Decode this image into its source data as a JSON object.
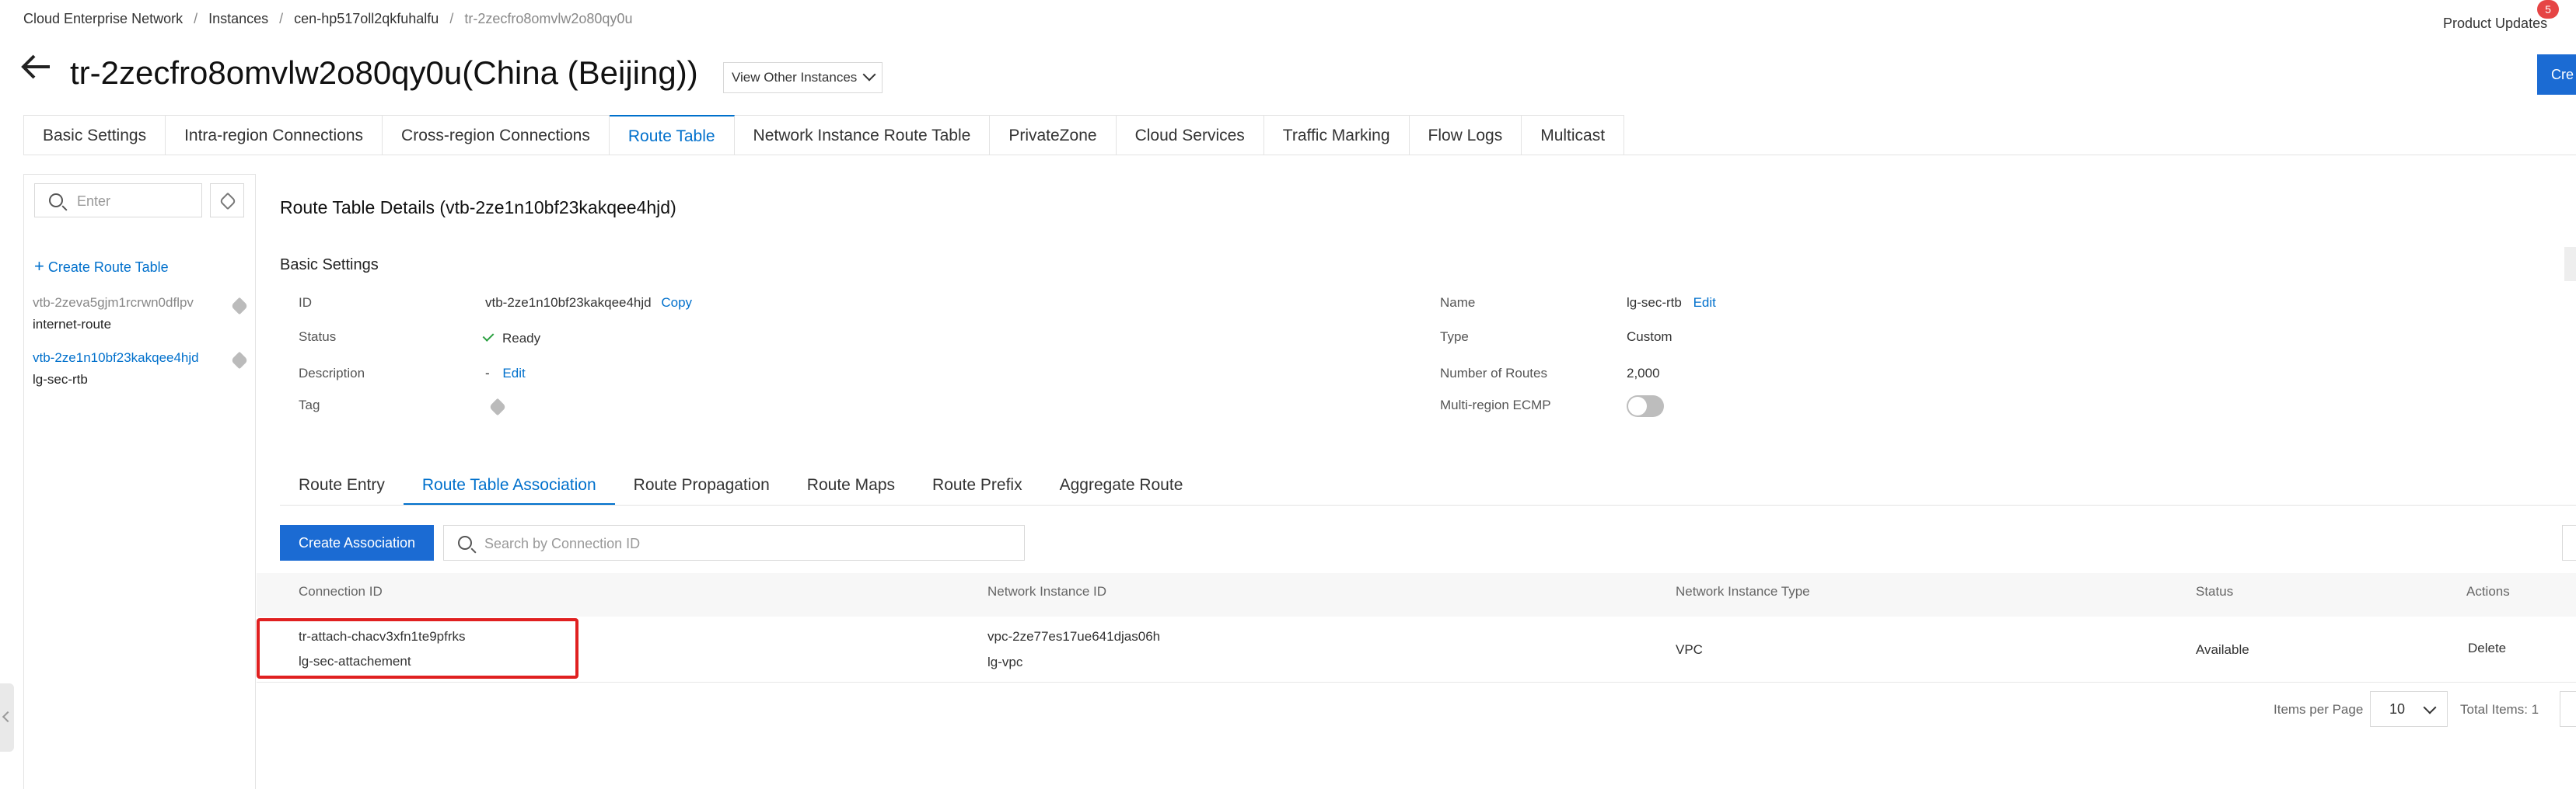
{
  "breadcrumb": [
    "Cloud Enterprise Network",
    "Instances",
    "cen-hp517oll2qkfuhalfu",
    "tr-2zecfro8omvlw2o80qy0u"
  ],
  "header": {
    "product_updates": "Product Updates",
    "badge_count": "5",
    "create_button": "Cre",
    "title": "tr-2zecfro8omvlw2o80qy0u(China (Beijing))",
    "view_other": "View Other Instances"
  },
  "tabs": [
    {
      "label": "Basic Settings"
    },
    {
      "label": "Intra-region Connections"
    },
    {
      "label": "Cross-region Connections"
    },
    {
      "label": "Route Table",
      "active": true
    },
    {
      "label": "Network Instance Route Table"
    },
    {
      "label": "PrivateZone"
    },
    {
      "label": "Cloud Services"
    },
    {
      "label": "Traffic Marking"
    },
    {
      "label": "Flow Logs"
    },
    {
      "label": "Multicast"
    }
  ],
  "sidebar": {
    "search_placeholder": "Enter",
    "create_label": "Create Route Table",
    "items": [
      {
        "id": "vtb-2zeva5gjm1rcrwn0dflpv",
        "name": "internet-route",
        "selected": false
      },
      {
        "id": "vtb-2ze1n10bf23kakqee4hjd",
        "name": "lg-sec-rtb",
        "selected": true
      }
    ]
  },
  "details": {
    "title": "Route Table Details (vtb-2ze1n10bf23kakqee4hjd)",
    "section": "Basic Settings",
    "id_label": "ID",
    "id_value": "vtb-2ze1n10bf23kakqee4hjd",
    "copy": "Copy",
    "status_label": "Status",
    "status_value": "Ready",
    "desc_label": "Description",
    "desc_value": "-",
    "desc_edit": "Edit",
    "tag_label": "Tag",
    "name_label": "Name",
    "name_value": "lg-sec-rtb",
    "name_edit": "Edit",
    "type_label": "Type",
    "type_value": "Custom",
    "routes_label": "Number of Routes",
    "routes_value": "2,000",
    "ecmp_label": "Multi-region ECMP",
    "ecmp_enabled": false
  },
  "subtabs": [
    {
      "label": "Route Entry"
    },
    {
      "label": "Route Table Association",
      "active": true
    },
    {
      "label": "Route Propagation"
    },
    {
      "label": "Route Maps"
    },
    {
      "label": "Route Prefix"
    },
    {
      "label": "Aggregate Route"
    }
  ],
  "association": {
    "create_button": "Create Association",
    "search_placeholder": "Search by Connection ID",
    "columns": [
      "Connection ID",
      "Network Instance ID",
      "Network Instance Type",
      "Status",
      "Actions"
    ],
    "rows": [
      {
        "connection_id": "tr-attach-chacv3xfn1te9pfrks",
        "connection_name": "lg-sec-attachement",
        "instance_id": "vpc-2ze77es17ue641djas06h",
        "instance_name": "lg-vpc",
        "instance_type": "VPC",
        "status": "Available",
        "action": "Delete"
      }
    ]
  },
  "pagination": {
    "items_per_page_label": "Items per Page",
    "items_per_page": "10",
    "total": "Total Items: 1"
  },
  "colors": {
    "accent": "#0070cc",
    "primary_button": "#1b6bd3",
    "highlight": "#e02020",
    "badge": "#e64545"
  }
}
